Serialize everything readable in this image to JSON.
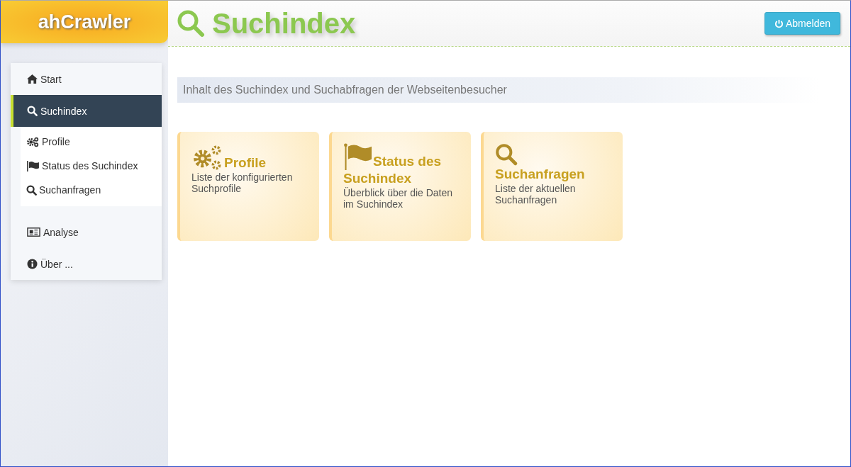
{
  "logo": "ahCrawler",
  "header": {
    "title": "Suchindex",
    "logout_button": "Abmelden"
  },
  "nav": [
    {
      "label": "Start",
      "kind": "home",
      "selected": false
    },
    {
      "label": "Suchindex",
      "kind": "search",
      "selected": true,
      "children": [
        {
          "label": "Profile",
          "kind": "gears"
        },
        {
          "label": "Status des Suchindex",
          "kind": "flag"
        },
        {
          "label": "Suchanfragen",
          "kind": "search"
        }
      ]
    },
    {
      "label": "Analyse",
      "kind": "newspaper",
      "selected": false
    },
    {
      "label": "Über ...",
      "kind": "info",
      "selected": false
    }
  ],
  "intro": "Inhalt des Suchindex und Suchabfragen der Webseitenbesucher",
  "cards": [
    {
      "kind": "gears",
      "title": "Profile",
      "text": "Liste der konfigurierten Suchprofile"
    },
    {
      "kind": "flag",
      "title": "Status des Suchindex",
      "text": "Überblick über die Daten im Suchindex"
    },
    {
      "kind": "search",
      "title": "Suchanfragen",
      "text": "Liste der aktuellen Suchanfragen"
    }
  ]
}
